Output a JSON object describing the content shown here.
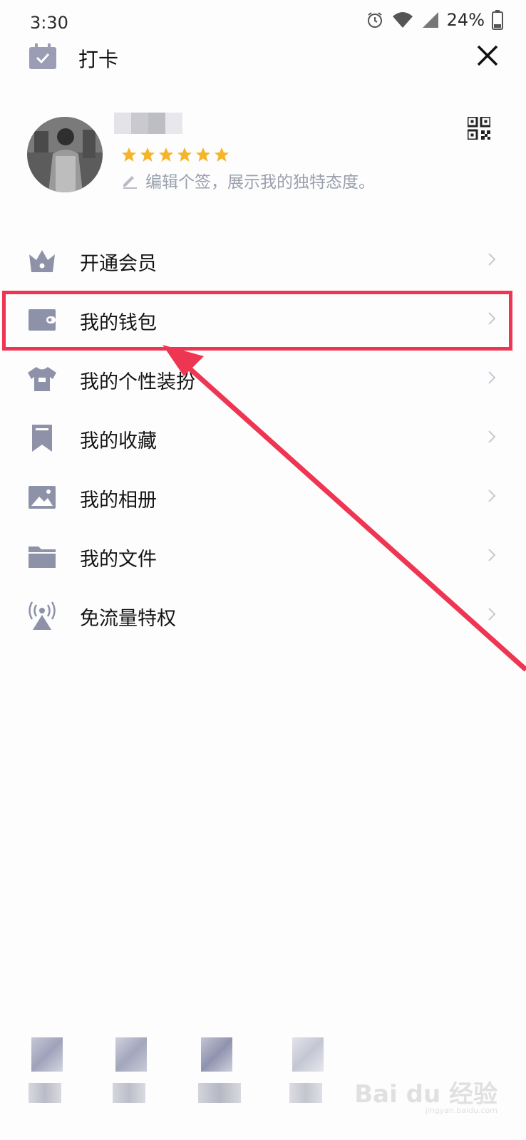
{
  "status_bar": {
    "time": "3:30",
    "battery": "24%"
  },
  "header": {
    "checkin_label": "打卡"
  },
  "profile": {
    "signature": "编辑个签，展示我的独特态度。",
    "star_count": 6
  },
  "menu": [
    {
      "label": "开通会员",
      "icon": "vip-crown-icon"
    },
    {
      "label": "我的钱包",
      "icon": "wallet-icon"
    },
    {
      "label": "我的个性装扮",
      "icon": "shirt-icon"
    },
    {
      "label": "我的收藏",
      "icon": "bookmark-icon"
    },
    {
      "label": "我的相册",
      "icon": "photo-icon"
    },
    {
      "label": "我的文件",
      "icon": "folder-icon"
    },
    {
      "label": "免流量特权",
      "icon": "signal-tower-icon"
    }
  ],
  "colors": {
    "icon": "#8e92a8",
    "highlight": "#ee3552",
    "star": "#f5b52a"
  },
  "watermark": {
    "brand": "Bai du 经验",
    "url": "jingyan.baidu.com"
  }
}
